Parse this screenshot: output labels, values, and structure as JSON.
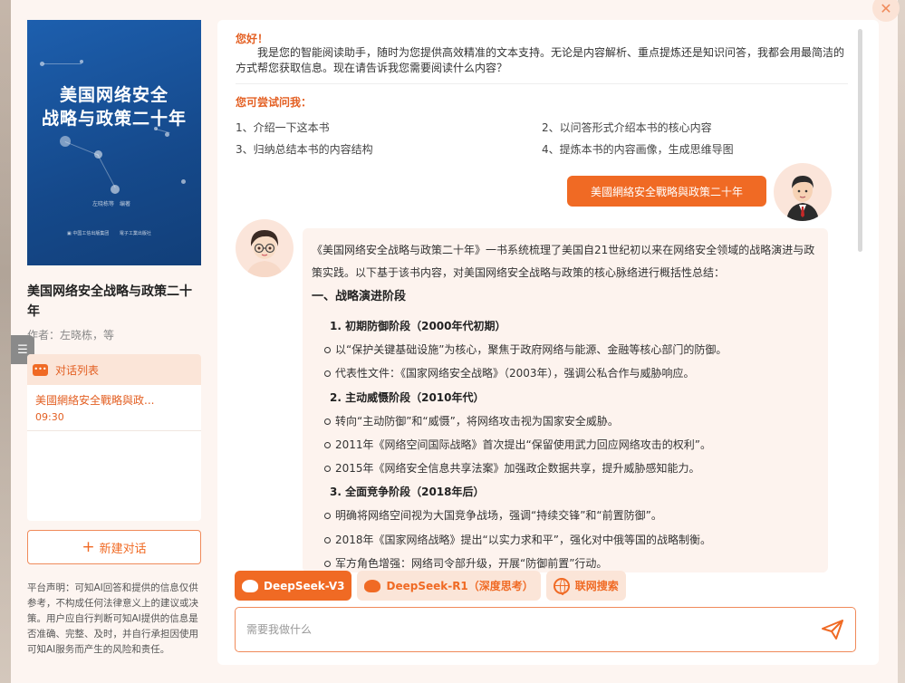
{
  "book": {
    "cover_line1": "美国网络安全",
    "cover_line2": "战略与政策二十年",
    "title": "美国网络安全战略与政策二十年",
    "author": "作者：左晓栋，等"
  },
  "conversations": {
    "header": "对话列表",
    "items": [
      {
        "title": "美國網絡安全戰略與政...",
        "time": "09:30"
      }
    ]
  },
  "new_chat_label": "新建对话",
  "disclaimer": "平台声明：可知AI回答和提供的信息仅供参考，不构成任何法律意义上的建议或决策。用户应自行判断可知AI提供的信息是否准确、完整、及时，并自行承担因使用可知AI服务而产生的风险和责任。",
  "greeting": {
    "title": "您好！",
    "body": "我是您的智能阅读助手，随时为您提供高效精准的文本支持。无论是内容解析、重点提炼还是知识问答，我都会用最简洁的方式帮您获取信息。现在请告诉我您需要阅读什么内容？"
  },
  "suggestions": {
    "title": "您可尝试问我：",
    "items": [
      "1、介绍一下这本书",
      "2、以问答形式介绍本书的核心内容",
      "3、归纳总结本书的内容结构",
      "4、提炼本书的内容画像，生成思维导图"
    ]
  },
  "user_message": "美國網絡安全戰略與政策二十年",
  "ai_answer": {
    "intro": "《美国网络安全战略与政策二十年》一书系统梳理了美国自21世纪初以来在网络安全领域的战略演进与政策实践。以下基于该书内容，对美国网络安全战略与政策的核心脉络进行概括性总结：",
    "heading": "一、战略演进阶段",
    "phases": [
      {
        "title": "初期防御阶段（2000年代初期）",
        "bullets": [
          "以“保护关键基础设施”为核心，聚焦于政府网络与能源、金融等核心部门的防御。",
          "代表性文件：《国家网络安全战略》（2003年），强调公私合作与威胁响应。"
        ]
      },
      {
        "title": "主动威慑阶段（2010年代）",
        "bullets": [
          "转向“主动防御”和“威慑”，将网络攻击视为国家安全威胁。",
          "2011年《网络空间国际战略》首次提出“保留使用武力回应网络攻击的权利”。",
          "2015年《网络安全信息共享法案》加强政企数据共享，提升威胁感知能力。"
        ]
      },
      {
        "title": "全面竞争阶段（2018年后）",
        "bullets": [
          "明确将网络空间视为大国竞争战场，强调“持续交锋”和“前置防御”。",
          "2018年《国家网络战略》提出“以实力求和平”，强化对中俄等国的战略制衡。",
          "军方角色增强：网络司令部升级，开展“防御前置”行动。"
        ]
      }
    ]
  },
  "models": [
    {
      "label": "DeepSeek-V3",
      "active": true
    },
    {
      "label": "DeepSeek-R1（深度思考）",
      "active": false
    },
    {
      "label": "联网搜索",
      "active": false
    }
  ],
  "input": {
    "placeholder": "需要我做什么",
    "value": ""
  },
  "colors": {
    "accent": "#f06a24",
    "accent_light": "#fbe5d8",
    "cover_blue": "#1a55a0"
  }
}
